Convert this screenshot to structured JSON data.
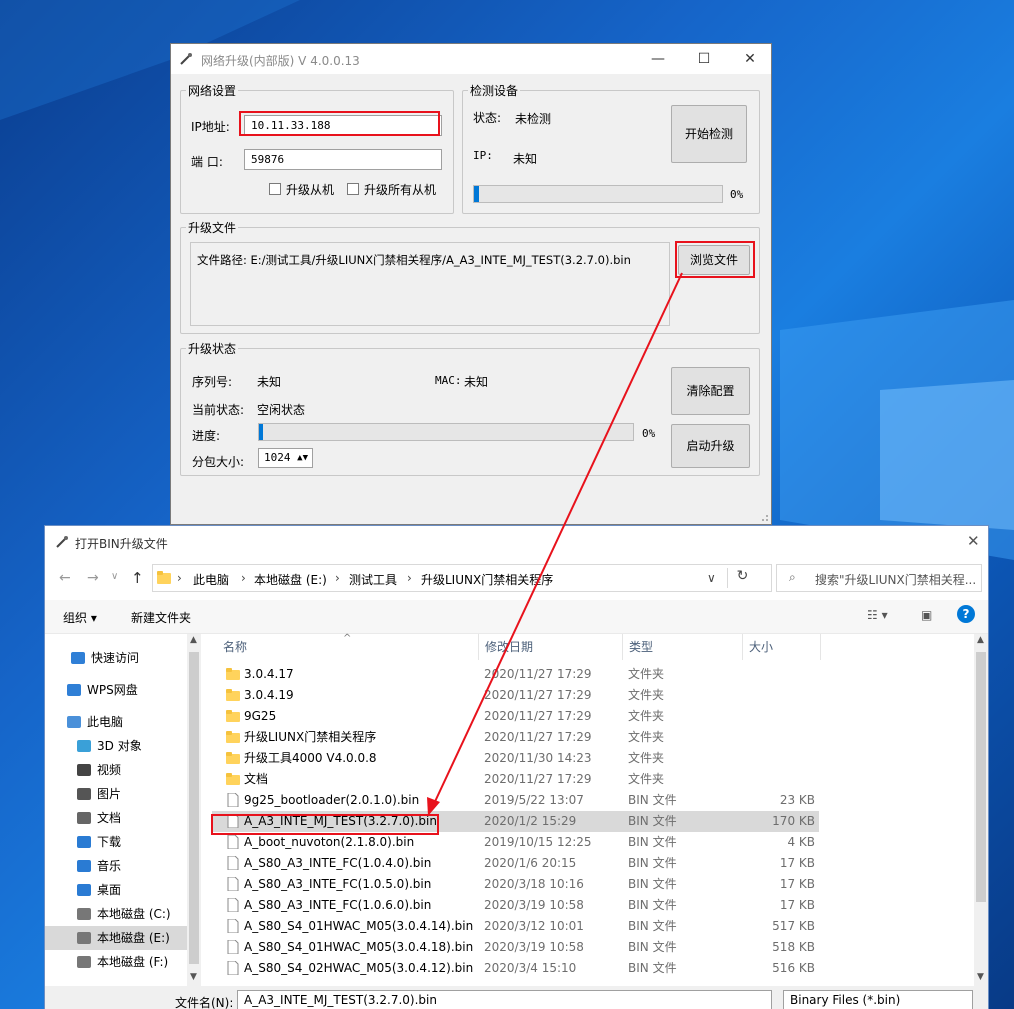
{
  "tool": {
    "title": "网络升级(内部版) V 4.0.0.13",
    "net_settings": {
      "title": "网络设置",
      "ip_label": "IP地址:",
      "ip_value": "10.11.33.188",
      "port_label": "端  口:",
      "port_value": "59876",
      "upgrade_slave_label": "升级从机",
      "upgrade_all_slaves_label": "升级所有从机"
    },
    "detect": {
      "title": "检测设备",
      "status_label": "状态:",
      "status_value": "未检测",
      "ip_label": "IP:",
      "ip_value": "未知",
      "start_detect_label": "开始检测",
      "progress_text": "0%",
      "progress": 0.02
    },
    "upgrade_file": {
      "title": "升级文件",
      "path_text": "文件路径: E:/测试工具/升级LIUNX门禁相关程序/A_A3_INTE_MJ_TEST(3.2.7.0).bin",
      "browse_label": "浏览文件"
    },
    "upgrade_status": {
      "title": "升级状态",
      "serial_label": "序列号:",
      "serial_value": "未知",
      "mac_label": "MAC:",
      "mac_value": "未知",
      "current_state_label": "当前状态:",
      "current_state_value": "空闲状态",
      "progress_label": "进度:",
      "progress_text": "0%",
      "progress": 0.01,
      "packet_size_label": "分包大小:",
      "packet_size_value": "1024",
      "clear_config_label": "清除配置",
      "start_upgrade_label": "启动升级"
    }
  },
  "dialog": {
    "title": "打开BIN升级文件",
    "breadcrumb": [
      "此电脑",
      "本地磁盘 (E:)",
      "测试工具",
      "升级LIUNX门禁相关程序"
    ],
    "search_placeholder": "搜索\"升级LIUNX门禁相关程...",
    "organize_label": "组织 ▾",
    "new_folder_label": "新建文件夹",
    "nav_items": [
      {
        "label": "快速访问",
        "icon": "star-icon"
      },
      {
        "label": "WPS网盘",
        "icon": "cloud-icon"
      },
      {
        "label": "此电脑",
        "icon": "computer-icon"
      },
      {
        "label": "3D 对象",
        "icon": "cube-icon"
      },
      {
        "label": "视频",
        "icon": "video-icon"
      },
      {
        "label": "图片",
        "icon": "picture-icon"
      },
      {
        "label": "文档",
        "icon": "document-icon"
      },
      {
        "label": "下载",
        "icon": "download-icon"
      },
      {
        "label": "音乐",
        "icon": "music-icon"
      },
      {
        "label": "桌面",
        "icon": "desktop-icon"
      },
      {
        "label": "本地磁盘 (C:)",
        "icon": "drive-icon"
      },
      {
        "label": "本地磁盘 (E:)",
        "icon": "drive-icon"
      },
      {
        "label": "本地磁盘 (F:)",
        "icon": "drive-icon"
      }
    ],
    "columns": {
      "name": "名称",
      "date": "修改日期",
      "type": "类型",
      "size": "大小"
    },
    "files": [
      {
        "name": "3.0.4.17",
        "date": "2020/11/27 17:29",
        "type": "文件夹",
        "size": "",
        "kind": "folder"
      },
      {
        "name": "3.0.4.19",
        "date": "2020/11/27 17:29",
        "type": "文件夹",
        "size": "",
        "kind": "folder"
      },
      {
        "name": "9G25",
        "date": "2020/11/27 17:29",
        "type": "文件夹",
        "size": "",
        "kind": "folder"
      },
      {
        "name": "升级LIUNX门禁相关程序",
        "date": "2020/11/27 17:29",
        "type": "文件夹",
        "size": "",
        "kind": "folder"
      },
      {
        "name": "升级工具4000 V4.0.0.8",
        "date": "2020/11/30 14:23",
        "type": "文件夹",
        "size": "",
        "kind": "folder"
      },
      {
        "name": "文档",
        "date": "2020/11/27 17:29",
        "type": "文件夹",
        "size": "",
        "kind": "folder"
      },
      {
        "name": "9g25_bootloader(2.0.1.0).bin",
        "date": "2019/5/22 13:07",
        "type": "BIN 文件",
        "size": "23 KB",
        "kind": "file"
      },
      {
        "name": "A_A3_INTE_MJ_TEST(3.2.7.0).bin",
        "date": "2020/1/2 15:29",
        "type": "BIN 文件",
        "size": "170 KB",
        "kind": "file"
      },
      {
        "name": "A_boot_nuvoton(2.1.8.0).bin",
        "date": "2019/10/15 12:25",
        "type": "BIN 文件",
        "size": "4 KB",
        "kind": "file"
      },
      {
        "name": "A_S80_A3_INTE_FC(1.0.4.0).bin",
        "date": "2020/1/6 20:15",
        "type": "BIN 文件",
        "size": "17 KB",
        "kind": "file"
      },
      {
        "name": "A_S80_A3_INTE_FC(1.0.5.0).bin",
        "date": "2020/3/18 10:16",
        "type": "BIN 文件",
        "size": "17 KB",
        "kind": "file"
      },
      {
        "name": "A_S80_A3_INTE_FC(1.0.6.0).bin",
        "date": "2020/3/19 10:58",
        "type": "BIN 文件",
        "size": "17 KB",
        "kind": "file"
      },
      {
        "name": "A_S80_S4_01HWAC_M05(3.0.4.14).bin",
        "date": "2020/3/12 10:01",
        "type": "BIN 文件",
        "size": "517 KB",
        "kind": "file"
      },
      {
        "name": "A_S80_S4_01HWAC_M05(3.0.4.18).bin",
        "date": "2020/3/19 10:58",
        "type": "BIN 文件",
        "size": "518 KB",
        "kind": "file"
      },
      {
        "name": "A_S80_S4_02HWAC_M05(3.0.4.12).bin",
        "date": "2020/3/4 15:10",
        "type": "BIN 文件",
        "size": "516 KB",
        "kind": "file"
      }
    ],
    "filename_label": "文件名(N):",
    "filename_value": "A_A3_INTE_MJ_TEST(3.2.7.0).bin",
    "filetype_value": "Binary Files (*.bin)"
  },
  "colors": {
    "highlight": "#e8121c",
    "progress": "#06b025",
    "accent": "#0078d7"
  }
}
